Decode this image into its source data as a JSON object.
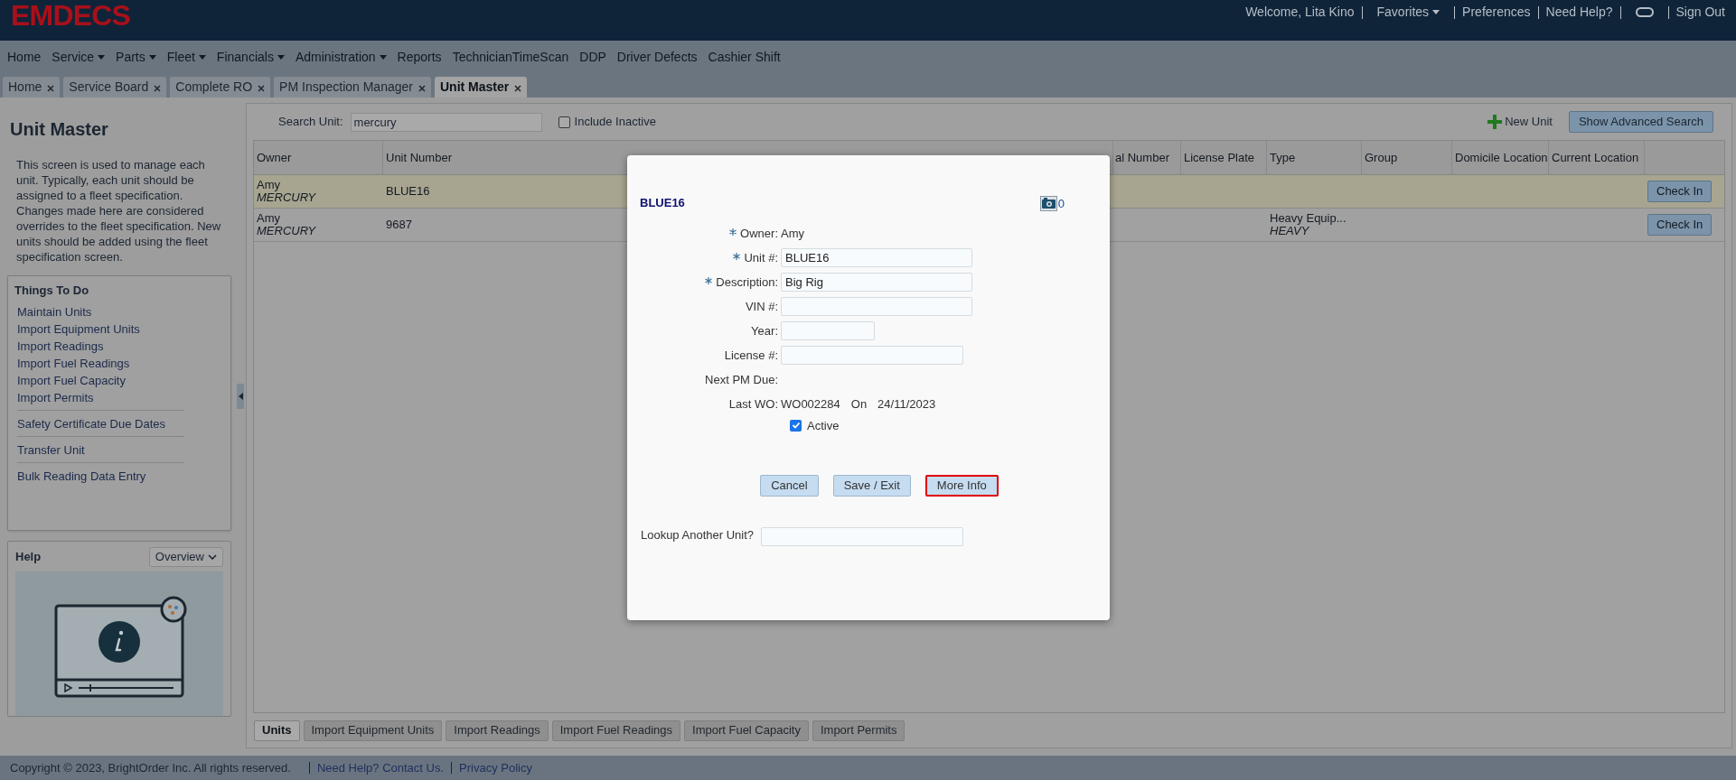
{
  "header": {
    "logo": "EMDECS",
    "links": [
      {
        "kind": "text",
        "label": "Welcome, Lita Kino"
      },
      {
        "kind": "dropdown",
        "label": "Favorites"
      },
      {
        "kind": "link",
        "label": "Preferences"
      },
      {
        "kind": "link",
        "label": "Need Help?"
      },
      {
        "kind": "toggle"
      },
      {
        "kind": "link",
        "label": "Sign Out"
      }
    ]
  },
  "menu": [
    {
      "label": "Home",
      "dropdown": false
    },
    {
      "label": "Service",
      "dropdown": true
    },
    {
      "label": "Parts",
      "dropdown": true
    },
    {
      "label": "Fleet",
      "dropdown": true
    },
    {
      "label": "Financials",
      "dropdown": true
    },
    {
      "label": "Administration",
      "dropdown": true
    },
    {
      "label": "Reports",
      "dropdown": false
    },
    {
      "label": "TechnicianTimeScan",
      "dropdown": false
    },
    {
      "label": "DDP",
      "dropdown": false
    },
    {
      "label": "Driver Defects",
      "dropdown": false
    },
    {
      "label": "Cashier Shift",
      "dropdown": false
    }
  ],
  "tabs": [
    {
      "label": "Home",
      "selected": false
    },
    {
      "label": "Service Board",
      "selected": false
    },
    {
      "label": "Complete RO",
      "selected": false
    },
    {
      "label": "PM Inspection Manager",
      "selected": false
    },
    {
      "label": "Unit Master",
      "selected": true
    }
  ],
  "sidebar": {
    "title": "Unit Master",
    "description": "This screen is used to manage each unit. Typically, each unit should be assigned to a fleet specification. Changes made here are considered overrides to the fleet specification. New units should be added using the fleet specification screen.",
    "things_to_do": {
      "title": "Things To Do",
      "groups": [
        [
          "Maintain Units",
          "Import Equipment Units",
          "Import Readings",
          "Import Fuel Readings",
          "Import Fuel Capacity",
          "Import Permits"
        ],
        [
          "Safety Certificate Due Dates"
        ],
        [
          "Transfer Unit"
        ],
        [
          "Bulk Reading Data Entry"
        ]
      ]
    },
    "help": {
      "title": "Help",
      "select": "Overview"
    }
  },
  "search": {
    "label": "Search Unit:",
    "value": "mercury",
    "include_inactive": {
      "label": "Include Inactive",
      "checked": false
    },
    "new_unit": "New Unit",
    "advanced": "Show Advanced Search"
  },
  "table": {
    "columns": [
      "Owner",
      "Unit Number",
      "al Number",
      "License Plate",
      "Type",
      "Group",
      "Domicile Location",
      "Current Location"
    ],
    "rows": [
      {
        "selected": true,
        "owner": "Amy",
        "owner_sub": "MERCURY",
        "unit_number": "BLUE16",
        "action": "Check In"
      },
      {
        "selected": false,
        "owner": "Amy",
        "owner_sub": "MERCURY",
        "unit_number": "9687",
        "type": "Heavy Equip...",
        "type_sub": "HEAVY",
        "action": "Check In"
      }
    ]
  },
  "bottom_tabs": [
    {
      "label": "Units",
      "selected": true
    },
    {
      "label": "Import Equipment Units",
      "selected": false
    },
    {
      "label": "Import Readings",
      "selected": false
    },
    {
      "label": "Import Fuel Readings",
      "selected": false
    },
    {
      "label": "Import Fuel Capacity",
      "selected": false
    },
    {
      "label": "Import Permits",
      "selected": false
    }
  ],
  "footer": {
    "copyright": "Copyright © 2023, BrightOrder Inc. All rights reserved.",
    "links": [
      "Need Help? Contact Us.",
      "Privacy Policy"
    ]
  },
  "dialog": {
    "title": "BLUE16",
    "photo_count": "0",
    "fields": [
      {
        "kind": "text",
        "label": "Owner:",
        "required": true,
        "value": "Amy"
      },
      {
        "kind": "input",
        "label": "Unit #:",
        "required": true,
        "value": "BLUE16"
      },
      {
        "kind": "input",
        "label": "Description:",
        "required": true,
        "value": "Big Rig"
      },
      {
        "kind": "input",
        "label": "VIN #:",
        "required": false
      },
      {
        "kind": "short",
        "label": "Year:",
        "required": false
      },
      {
        "kind": "medium",
        "label": "License #:",
        "required": false
      },
      {
        "kind": "text",
        "label": "Next PM Due:",
        "required": false
      },
      {
        "kind": "wo",
        "label": "Last WO:",
        "required": false,
        "value": "WO002284",
        "on": "On",
        "date": "24/11/2023"
      }
    ],
    "active": {
      "label": "Active",
      "checked": true
    },
    "buttons": [
      {
        "label": "Cancel",
        "focused": false
      },
      {
        "label": "Save / Exit",
        "focused": false
      },
      {
        "label": "More Info",
        "focused": true
      }
    ],
    "lookup": {
      "label": "Lookup Another Unit?"
    }
  }
}
